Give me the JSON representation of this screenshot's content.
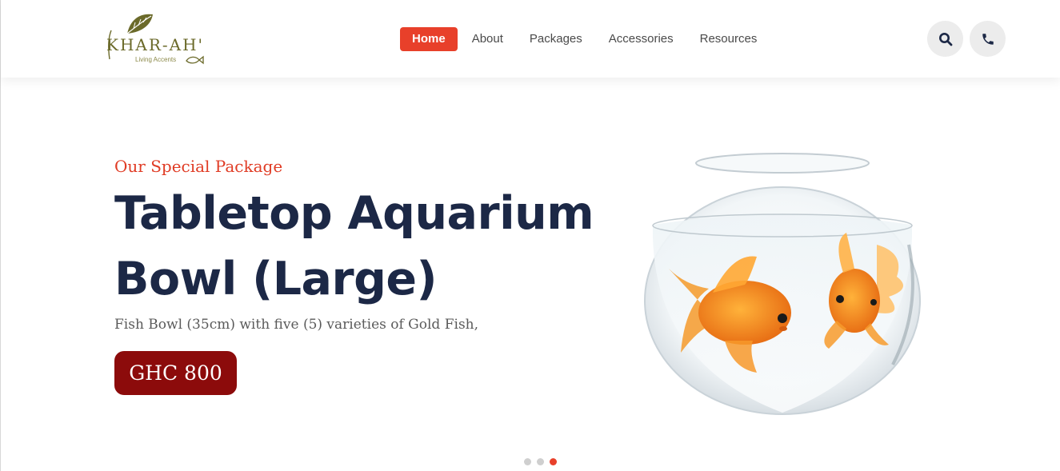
{
  "logo": {
    "brand": "KHAR-AH'",
    "tagline": "Living Accents"
  },
  "nav": {
    "items": [
      {
        "label": "Home",
        "active": true
      },
      {
        "label": "About"
      },
      {
        "label": "Packages"
      },
      {
        "label": "Accessories"
      },
      {
        "label": "Resources"
      }
    ]
  },
  "header_actions": {
    "search_icon": "search-icon",
    "phone_icon": "phone-icon"
  },
  "hero": {
    "subtitle": "Our Special Package",
    "title_line1": "Tabletop Aquarium",
    "title_line2": "Bowl (Large)",
    "description": "Fish Bowl (35cm) with five (5) varieties of Gold Fish,",
    "price": "GHC 800"
  },
  "carousel": {
    "slide_count": 3,
    "active_slide": 3
  },
  "colors": {
    "accent": "#e8402a",
    "title": "#1c2846",
    "price_bg": "#8c0b0b",
    "logo": "#6b6a2a"
  }
}
